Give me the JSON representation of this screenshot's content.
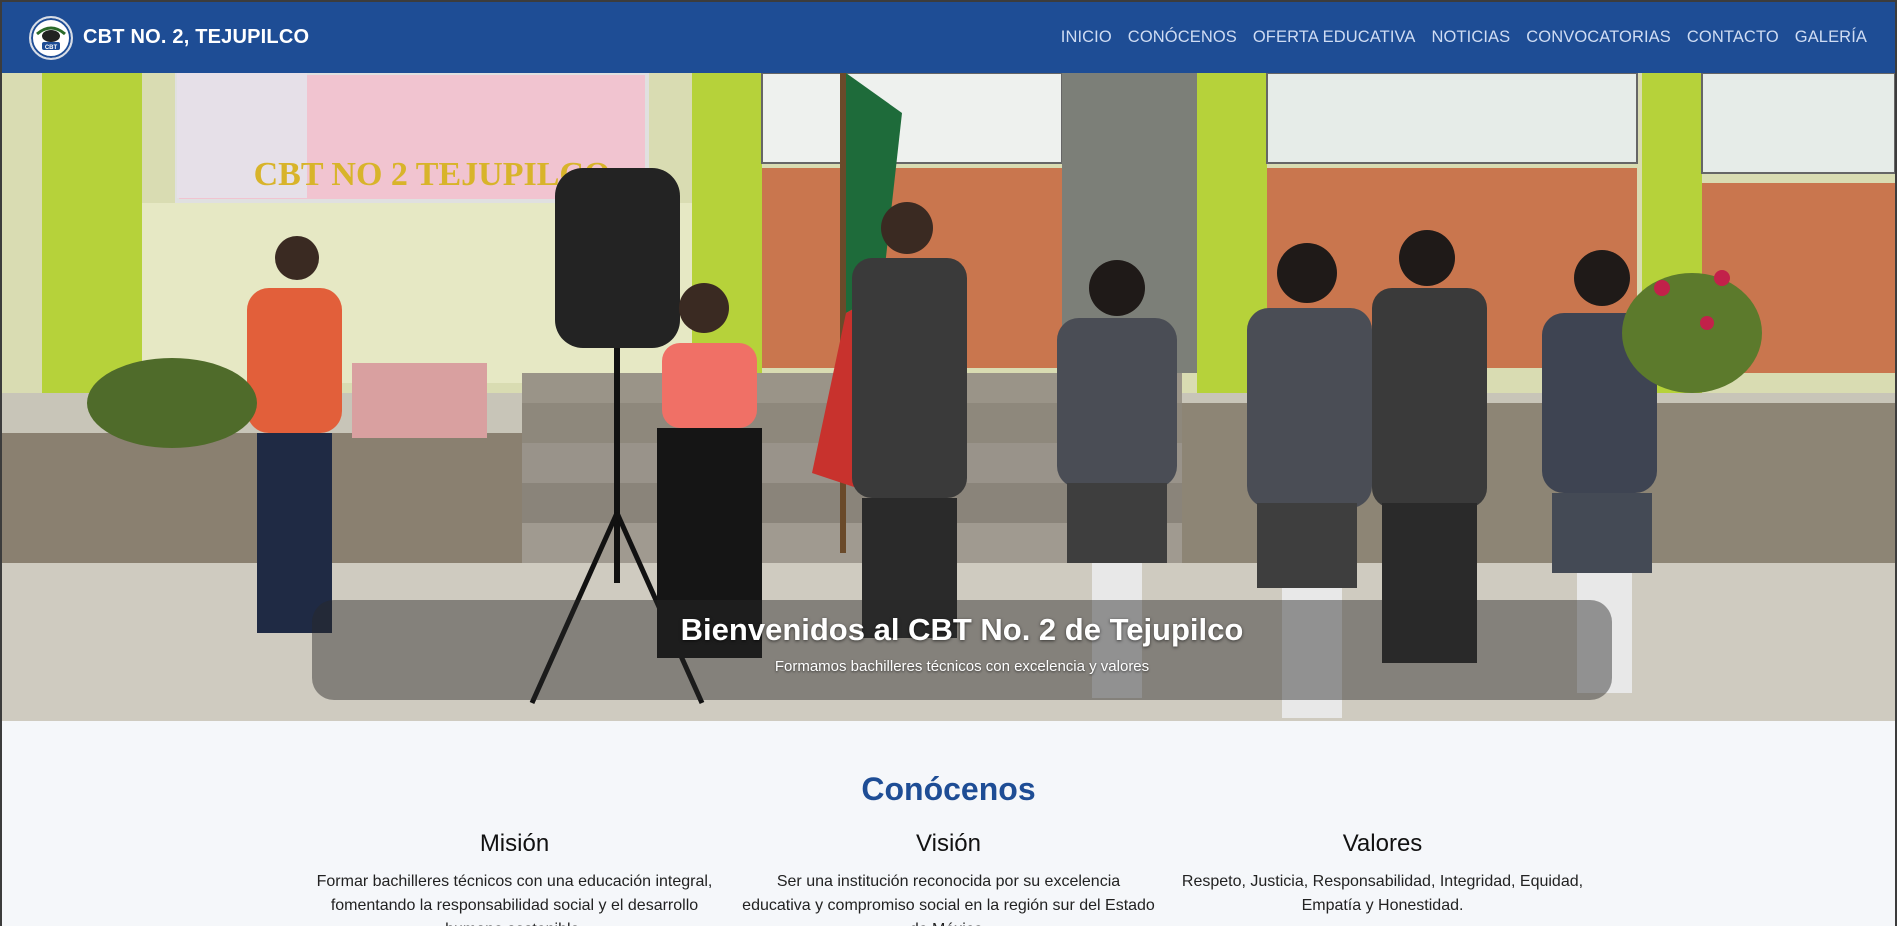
{
  "header": {
    "brand_name": "CBT NO. 2, TEJUPILCO",
    "logo_text": "CBT",
    "nav": [
      {
        "label": "INICIO"
      },
      {
        "label": "CONÓCENOS"
      },
      {
        "label": "OFERTA EDUCATIVA"
      },
      {
        "label": "NOTICIAS"
      },
      {
        "label": "CONVOCATORIAS"
      },
      {
        "label": "CONTACTO"
      },
      {
        "label": "GALERÍA"
      }
    ]
  },
  "hero": {
    "banner_text": "CBT NO 2 TEJUPILCO",
    "title": "Bienvenidos al CBT No. 2 de Tejupilco",
    "subtitle": "Formamos bachilleres técnicos con excelencia y valores"
  },
  "about": {
    "heading": "Conócenos",
    "columns": [
      {
        "title": "Misión",
        "text": "Formar bachilleres técnicos con una educación integral, fomentando la responsabilidad social y el desarrollo humano sostenible."
      },
      {
        "title": "Visión",
        "text": "Ser una institución reconocida por su excelencia educativa y compromiso social en la región sur del Estado de México."
      },
      {
        "title": "Valores",
        "text": "Respeto, Justicia, Responsabilidad, Integridad, Equidad, Empatía y Honestidad."
      }
    ]
  },
  "colors": {
    "nav_bg": "#1e4d95",
    "accent": "#1e4d95"
  }
}
